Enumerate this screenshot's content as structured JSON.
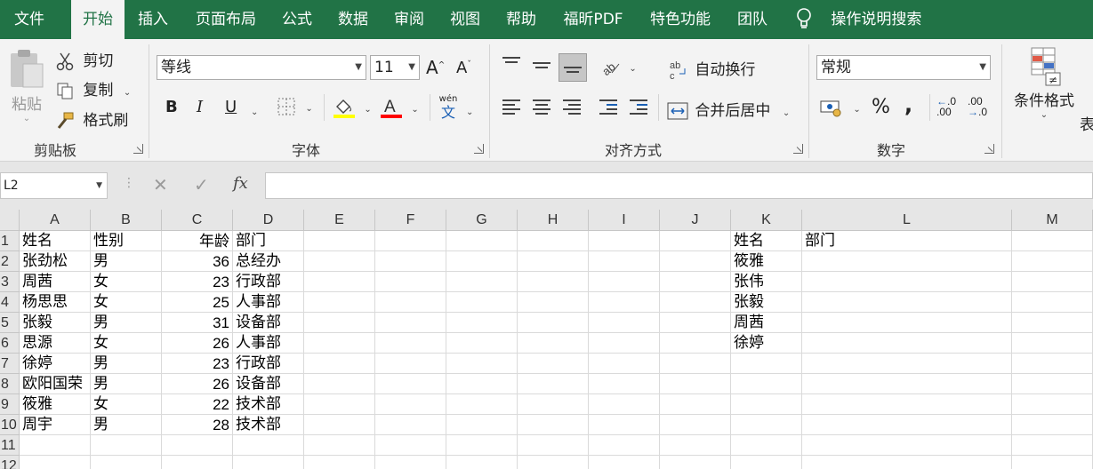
{
  "tabs": [
    "文件",
    "开始",
    "插入",
    "页面布局",
    "公式",
    "数据",
    "审阅",
    "视图",
    "帮助",
    "福昕PDF",
    "特色功能",
    "团队"
  ],
  "tell_me": "操作说明搜索",
  "clipboard": {
    "paste": "粘贴",
    "cut": "剪切",
    "copy": "复制",
    "format_painter": "格式刷",
    "group": "剪贴板"
  },
  "font": {
    "name": "等线",
    "size": "11",
    "bold": "B",
    "italic": "I",
    "underline": "U",
    "group": "字体",
    "wen": "wén",
    "wen2": "文"
  },
  "alignment": {
    "wrap": "自动换行",
    "merge": "合并后居中",
    "group": "对齐方式"
  },
  "number": {
    "format": "常规",
    "percent": "%",
    "comma": ",",
    "group": "数字"
  },
  "styles": {
    "conditional": "条件格式",
    "table_partial": "表"
  },
  "namebox": "L2",
  "formula_value": "",
  "columns": [
    "A",
    "B",
    "C",
    "D",
    "E",
    "F",
    "G",
    "H",
    "I",
    "J",
    "K",
    "L",
    "M"
  ],
  "rows": [
    "1",
    "2",
    "3",
    "4",
    "5",
    "6",
    "7",
    "8",
    "9",
    "10",
    "11",
    "12"
  ],
  "cells": {
    "A1": "姓名",
    "B1": "性别",
    "C1": "年龄",
    "D1": "部门",
    "A2": "张劲松",
    "B2": "男",
    "C2": "36",
    "D2": "总经办",
    "A3": "周茜",
    "B3": "女",
    "C3": "23",
    "D3": "行政部",
    "A4": "杨思思",
    "B4": "女",
    "C4": "25",
    "D4": "人事部",
    "A5": "张毅",
    "B5": "男",
    "C5": "31",
    "D5": "设备部",
    "A6": "思源",
    "B6": "女",
    "C6": "26",
    "D6": "人事部",
    "A7": "徐婷",
    "B7": "男",
    "C7": "23",
    "D7": "行政部",
    "A8": "欧阳国荣",
    "B8": "男",
    "C8": "26",
    "D8": "设备部",
    "A9": "筱雅",
    "B9": "女",
    "C9": "22",
    "D9": "技术部",
    "A10": "周宇",
    "B10": "男",
    "C10": "28",
    "D10": "技术部",
    "K1": "姓名",
    "L1": "部门",
    "K2": "筱雅",
    "K3": "张伟",
    "K4": "张毅",
    "K5": "周茜",
    "K6": "徐婷"
  },
  "colors": {
    "accent": "#217346",
    "font_highlight": "#ffff00",
    "font_color": "#ff0000"
  }
}
